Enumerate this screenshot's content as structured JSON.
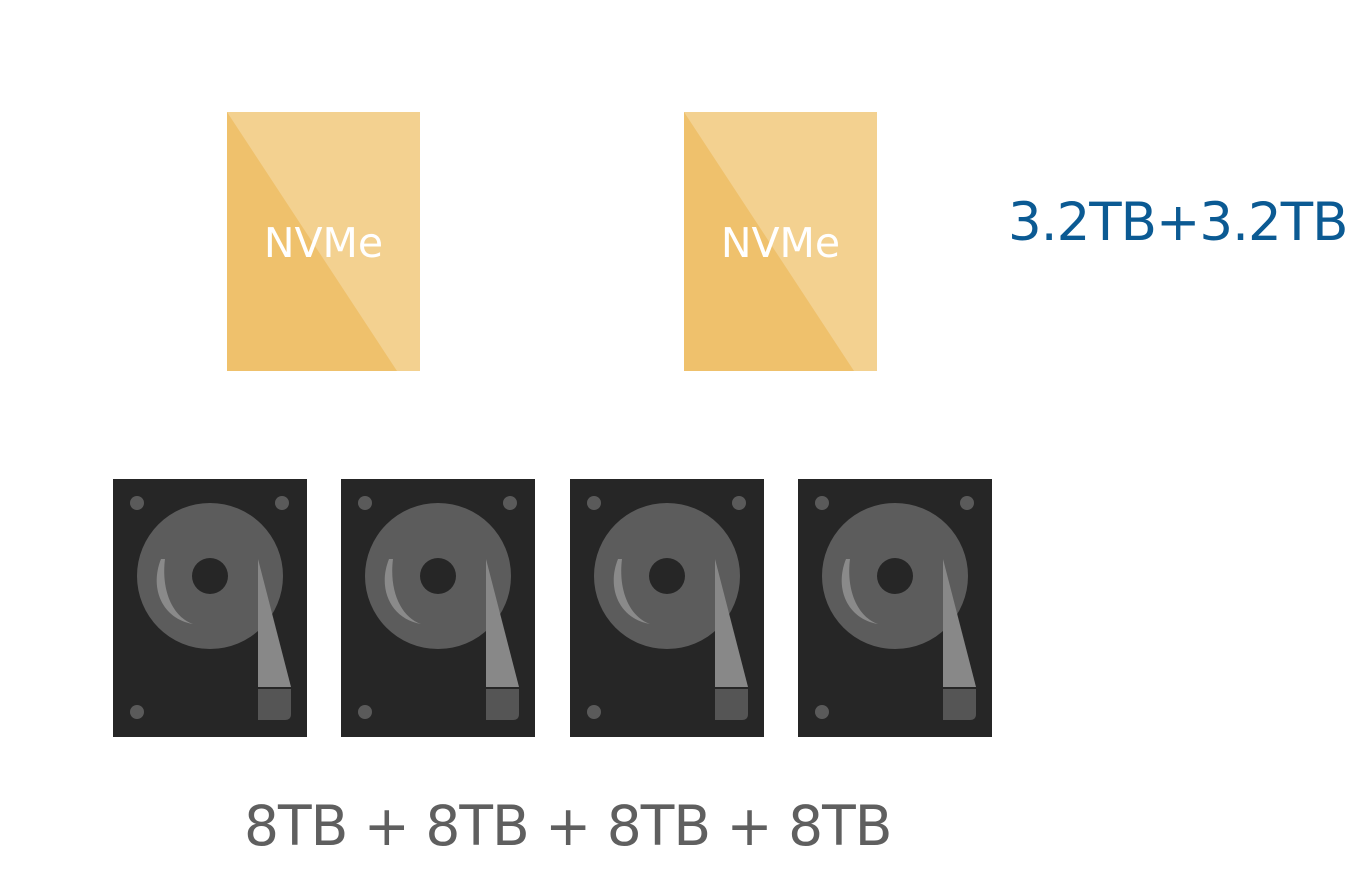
{
  "nvme_drives": [
    {
      "label": "NVMe"
    },
    {
      "label": "NVMe"
    }
  ],
  "ssd_capacity": "3.2TB+3.2TB",
  "hdd_drives": [
    {
      "icon": "hard-drive-icon"
    },
    {
      "icon": "hard-drive-icon"
    },
    {
      "icon": "hard-drive-icon"
    },
    {
      "icon": "hard-drive-icon"
    }
  ],
  "hdd_capacity": "8TB + 8TB + 8TB + 8TB",
  "colors": {
    "nvme_fill": "#efc16c",
    "nvme_highlight": "#f3d497",
    "ssd_capacity_text": "#0b5a93",
    "hdd_body": "#262626",
    "hdd_platter": "#5c5c5c",
    "hdd_arm": "#888888",
    "hdd_capacity_text": "#5f5f5f"
  }
}
